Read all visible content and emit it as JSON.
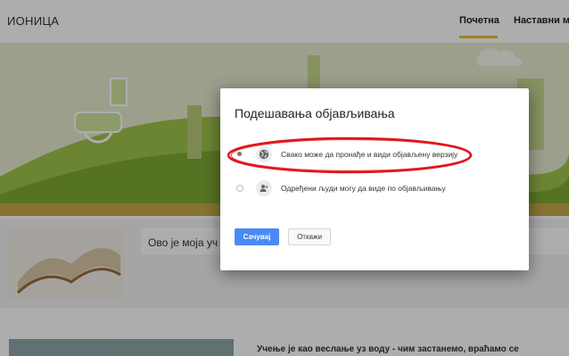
{
  "header": {
    "site_title": "ИОНИЦА",
    "nav_home": "Почетна",
    "nav_materials": "Наставни ма"
  },
  "intro": {
    "text": "Ово је моја уч"
  },
  "quote": {
    "text": "Учење је као веслање уз воду - чим застанемо, враћамо се"
  },
  "dialog": {
    "title": "Подешавања објављивања",
    "options": [
      {
        "label": "Свако може да пронађе и види објављену верзију",
        "selected": true,
        "icon": "globe-icon"
      },
      {
        "label": "Одређени људи могу да виде по објављивању",
        "selected": false,
        "icon": "people-icon"
      }
    ],
    "save_label": "Сачувај",
    "cancel_label": "Откажи"
  },
  "colors": {
    "accent": "#e8c230",
    "primary_button": "#4a8af4",
    "annotation": "#e0151b"
  }
}
